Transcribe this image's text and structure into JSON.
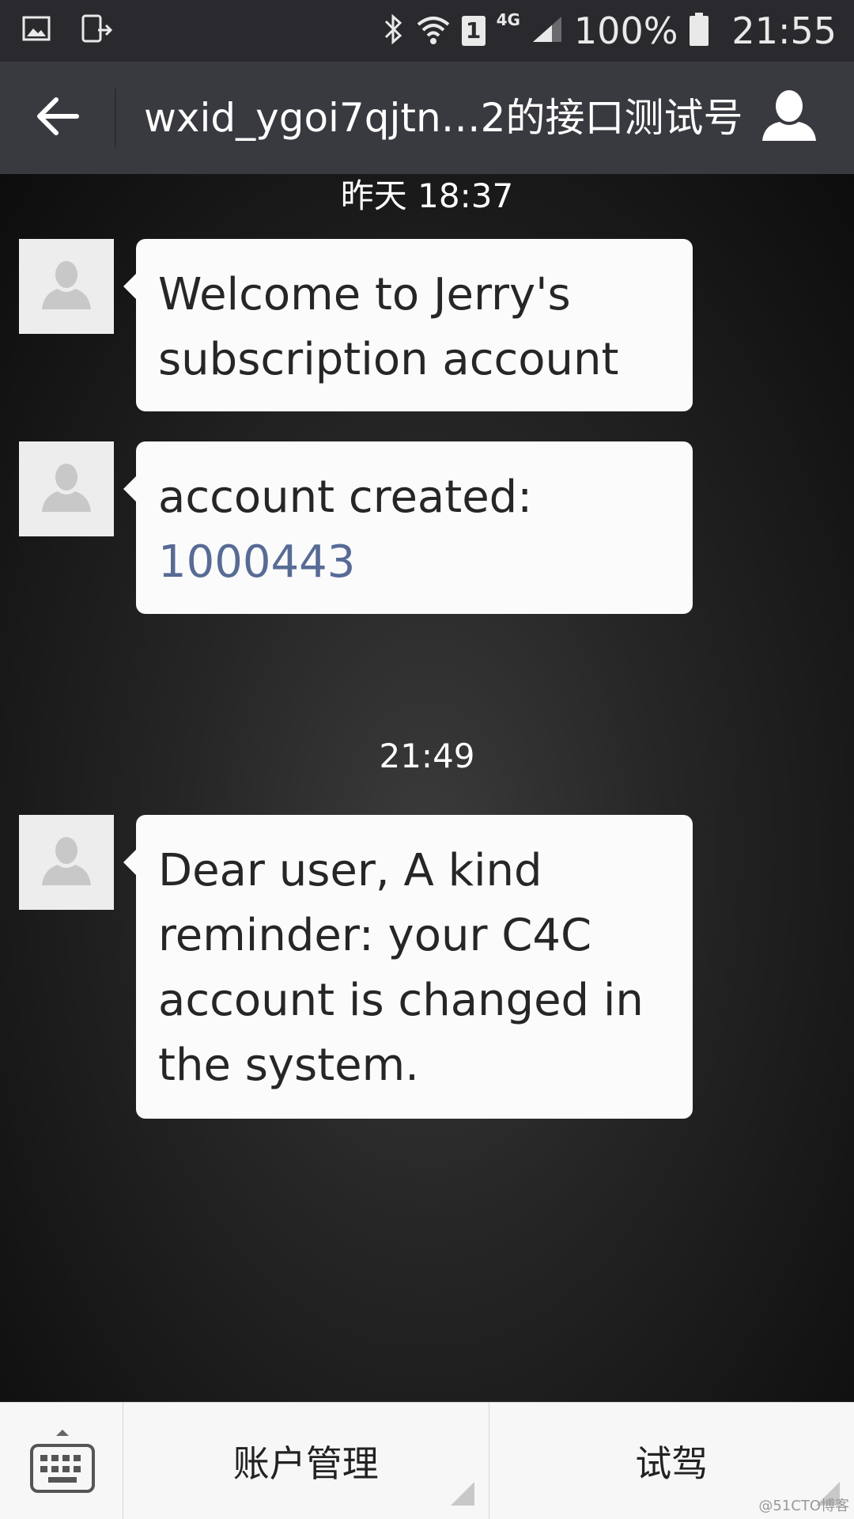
{
  "status_bar": {
    "network": "4G",
    "sim": "1",
    "battery": "100%",
    "time": "21:55"
  },
  "header": {
    "title": "wxid_ygoi7qjtn…2的接口测试号"
  },
  "chat": {
    "timestamp_1": "昨天 18:37",
    "message_1": "Welcome to Jerry's subscription account",
    "message_2_text": "account created:",
    "message_2_number": "1000443",
    "timestamp_2": "21:49",
    "message_3": "Dear user, A kind reminder: your C4C account is changed in the system."
  },
  "bottom_menu": {
    "item_1": "账户管理",
    "item_2": "试驾"
  },
  "watermark": "@51CTO博客"
}
